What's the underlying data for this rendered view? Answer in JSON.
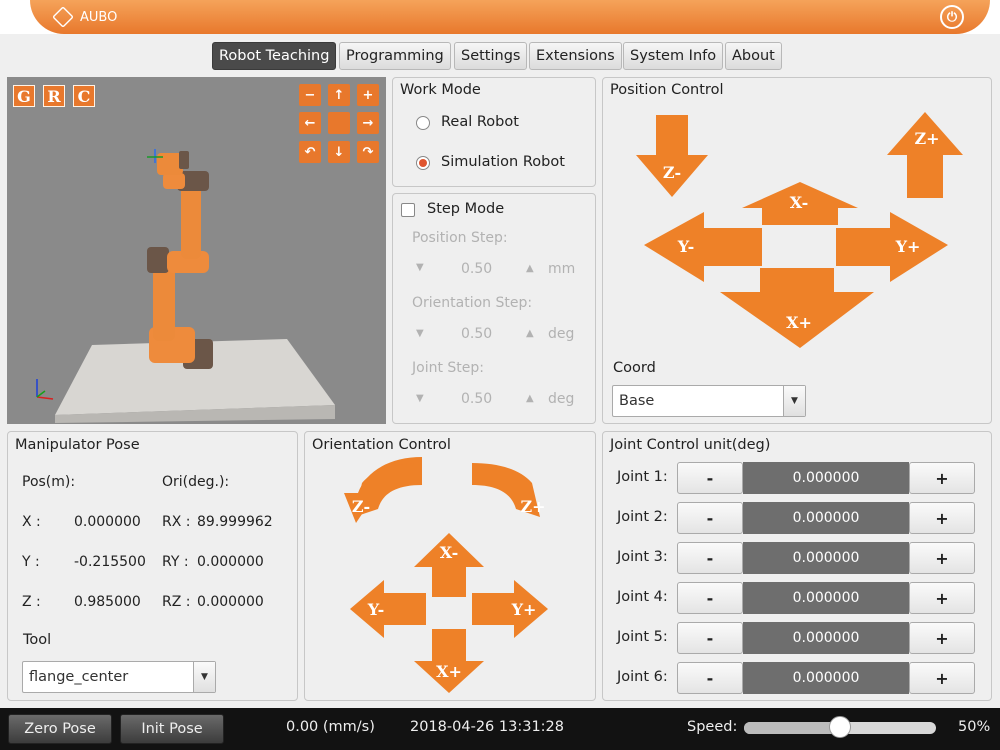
{
  "app": {
    "logo_text": "AUBO",
    "power_icon": "power-icon"
  },
  "tabs": [
    {
      "label": "Robot Teaching",
      "active": true
    },
    {
      "label": "Programming"
    },
    {
      "label": "Settings"
    },
    {
      "label": "Extensions"
    },
    {
      "label": "System Info"
    },
    {
      "label": "About"
    }
  ],
  "view3d": {
    "btn_g": "G",
    "btn_r": "R",
    "btn_c": "C"
  },
  "work_mode": {
    "title": "Work Mode",
    "options": [
      {
        "label": "Real Robot",
        "selected": false
      },
      {
        "label": "Simulation Robot",
        "selected": true
      }
    ]
  },
  "step_mode": {
    "title": "Step Mode",
    "checked": false,
    "position_step": {
      "label": "Position Step:",
      "value": "0.50",
      "unit": "mm"
    },
    "orientation_step": {
      "label": "Orientation Step:",
      "value": "0.50",
      "unit": "deg"
    },
    "joint_step": {
      "label": "Joint Step:",
      "value": "0.50",
      "unit": "deg"
    }
  },
  "position_control": {
    "title": "Position Control",
    "labels": {
      "z_minus": "Z-",
      "z_plus": "Z+",
      "x_minus": "X-",
      "x_plus": "X+",
      "y_minus": "Y-",
      "y_plus": "Y+"
    },
    "coord_label": "Coord",
    "coord_value": "Base"
  },
  "manipulator_pose": {
    "title": "Manipulator Pose",
    "pos_header": "Pos(m):",
    "ori_header": "Ori(deg.):",
    "rows": [
      {
        "axis": "X :",
        "pos": "0.000000",
        "ori_label": "RX :",
        "ori": "89.999962"
      },
      {
        "axis": "Y :",
        "pos": "-0.215500",
        "ori_label": "RY :",
        "ori": "0.000000"
      },
      {
        "axis": "Z :",
        "pos": "0.985000",
        "ori_label": "RZ :",
        "ori": "0.000000"
      }
    ],
    "tool_label": "Tool",
    "tool_value": "flange_center"
  },
  "orientation_control": {
    "title": "Orientation Control",
    "labels": {
      "z_minus": "Z-",
      "z_plus": "Z+",
      "x_minus": "X-",
      "x_plus": "X+",
      "y_minus": "Y-",
      "y_plus": "Y+"
    }
  },
  "joint_control": {
    "title": "Joint Control  unit(deg)",
    "minus": "-",
    "plus": "+",
    "joints": [
      {
        "label": "Joint 1:",
        "value": "0.000000"
      },
      {
        "label": "Joint 2:",
        "value": "0.000000"
      },
      {
        "label": "Joint 3:",
        "value": "0.000000"
      },
      {
        "label": "Joint 4:",
        "value": "0.000000"
      },
      {
        "label": "Joint 5:",
        "value": "0.000000"
      },
      {
        "label": "Joint 6:",
        "value": "0.000000"
      }
    ]
  },
  "status_bar": {
    "zero_pose": "Zero Pose",
    "init_pose": "Init Pose",
    "velocity": "0.00 (mm/s)",
    "datetime": "2018-04-26 13:31:28",
    "speed_label": "Speed:",
    "speed_value": "50%",
    "speed_fraction": 0.5
  },
  "colors": {
    "accent": "#ee8128",
    "title_bar": "#e8782c",
    "joint_value_bg": "#6e6e6e",
    "status_bg": "#121212"
  }
}
